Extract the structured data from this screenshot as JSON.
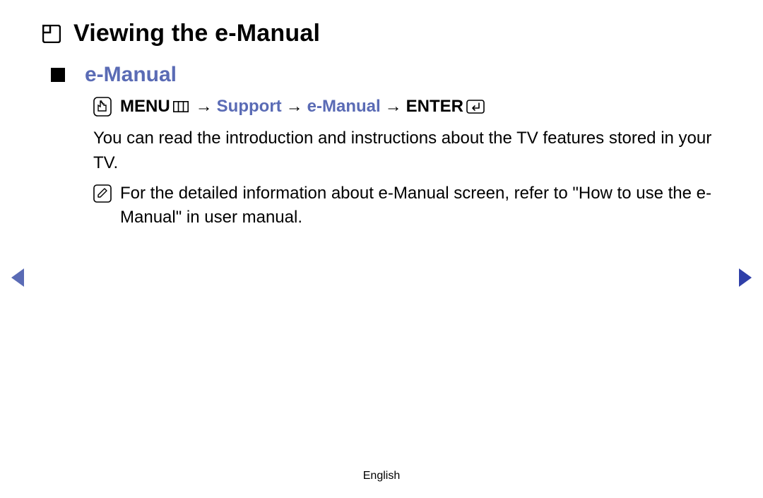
{
  "header": {
    "title": "Viewing the e-Manual"
  },
  "section": {
    "subtitle": "e-Manual",
    "nav_path": {
      "menu_label": "MENU",
      "arrow": "→",
      "support": "Support",
      "emanual": "e-Manual",
      "enter_label": "ENTER"
    },
    "body": "You can read the introduction and instructions about the TV features stored in your TV.",
    "note": "For the detailed information about e-Manual screen, refer to \"How to use the e-Manual\" in user manual."
  },
  "footer": {
    "language": "English"
  },
  "icons": {
    "section": "section-tab-icon",
    "bullet": "square-bullet",
    "hand": "hand-pointer-icon",
    "menu_button": "menu-button-icon",
    "enter_button": "enter-button-icon",
    "note": "pencil-note-icon",
    "prev": "nav-prev-icon",
    "next": "nav-next-icon"
  }
}
